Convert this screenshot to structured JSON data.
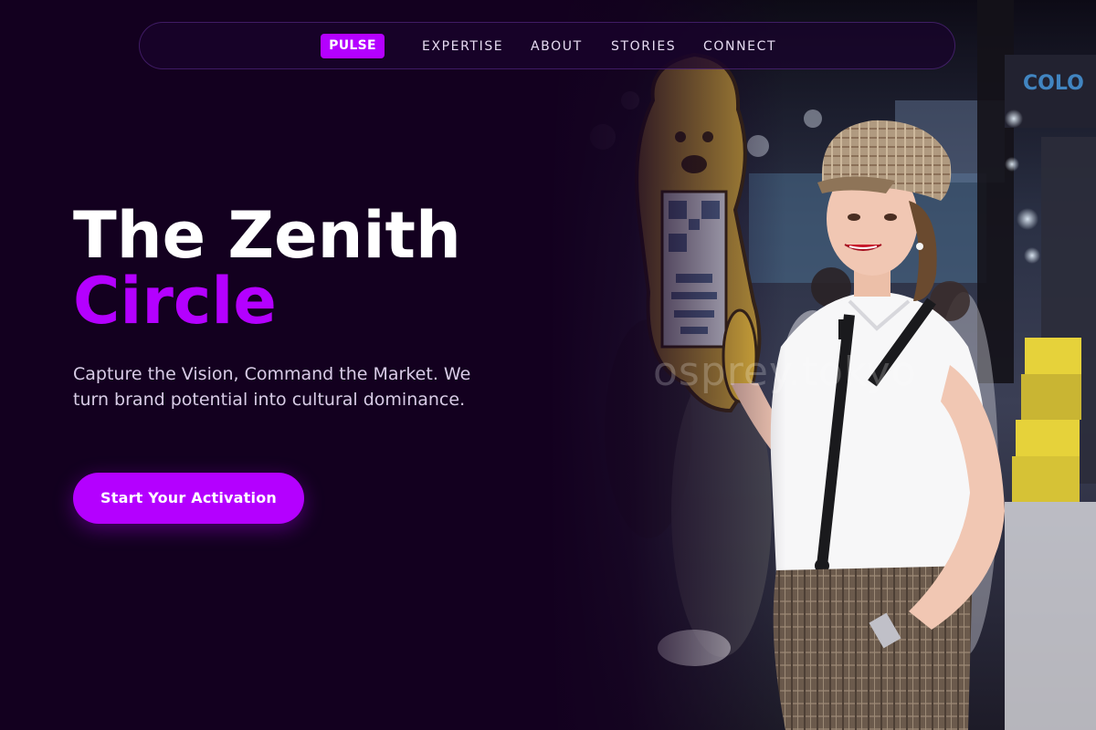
{
  "nav": {
    "brand": "PULSE",
    "links": [
      "EXPERTISE",
      "ABOUT",
      "STORIES",
      "CONNECT"
    ]
  },
  "hero": {
    "title_line1": "The Zenith",
    "title_line2": "Circle",
    "subtitle": "Capture the Vision, Command the Market. We turn brand potential into cultural dominance.",
    "cta_label": "Start Your Activation"
  },
  "photo": {
    "watermark": "osprey.tokyo",
    "subject": "woman in flat cap and suspenders holding a mascot sign at an event booth"
  },
  "colors": {
    "background": "#13001f",
    "accent": "#b400ff",
    "text": "#ffffff",
    "muted_text": "#d8cce6"
  }
}
